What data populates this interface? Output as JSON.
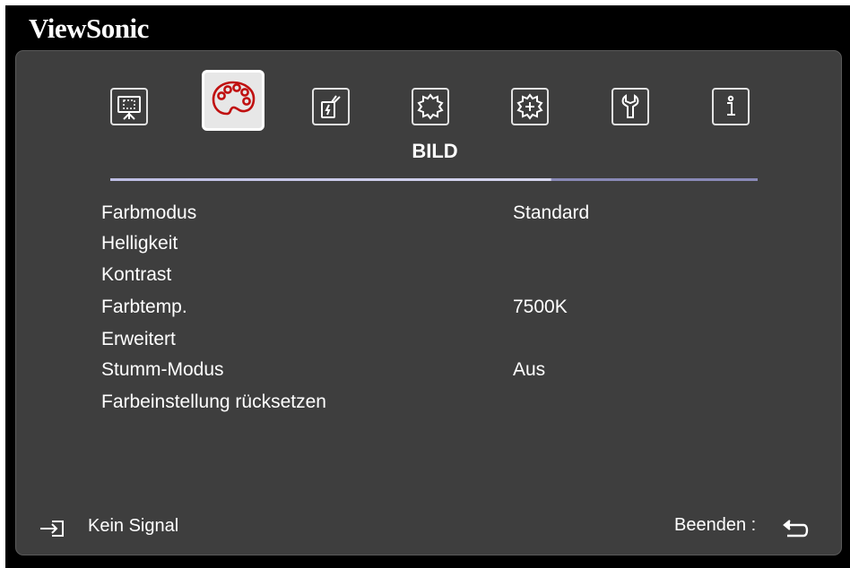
{
  "brand": "ViewSonic",
  "tabs": [
    {
      "name": "display-icon"
    },
    {
      "name": "palette-icon",
      "active": true
    },
    {
      "name": "power-icon"
    },
    {
      "name": "basic-settings-icon"
    },
    {
      "name": "advanced-settings-icon"
    },
    {
      "name": "wrench-icon"
    },
    {
      "name": "info-icon"
    }
  ],
  "active_tab_label": "BILD",
  "menu": [
    {
      "label": "Farbmodus",
      "value": "Standard"
    },
    {
      "label": "Helligkeit",
      "value": ""
    },
    {
      "label": "Kontrast",
      "value": ""
    },
    {
      "label": "Farbtemp.",
      "value": "7500K"
    },
    {
      "label": "Erweitert",
      "value": ""
    },
    {
      "label": "Stumm-Modus",
      "value": "Aus"
    },
    {
      "label": "Farbeinstellung rücksetzen",
      "value": ""
    }
  ],
  "footer": {
    "signal_text": "Kein Signal",
    "exit_text": "Beenden :"
  },
  "colors": {
    "panel": "#3e3e3e",
    "divider": "#d6d6ef",
    "text": "#ffffff"
  }
}
